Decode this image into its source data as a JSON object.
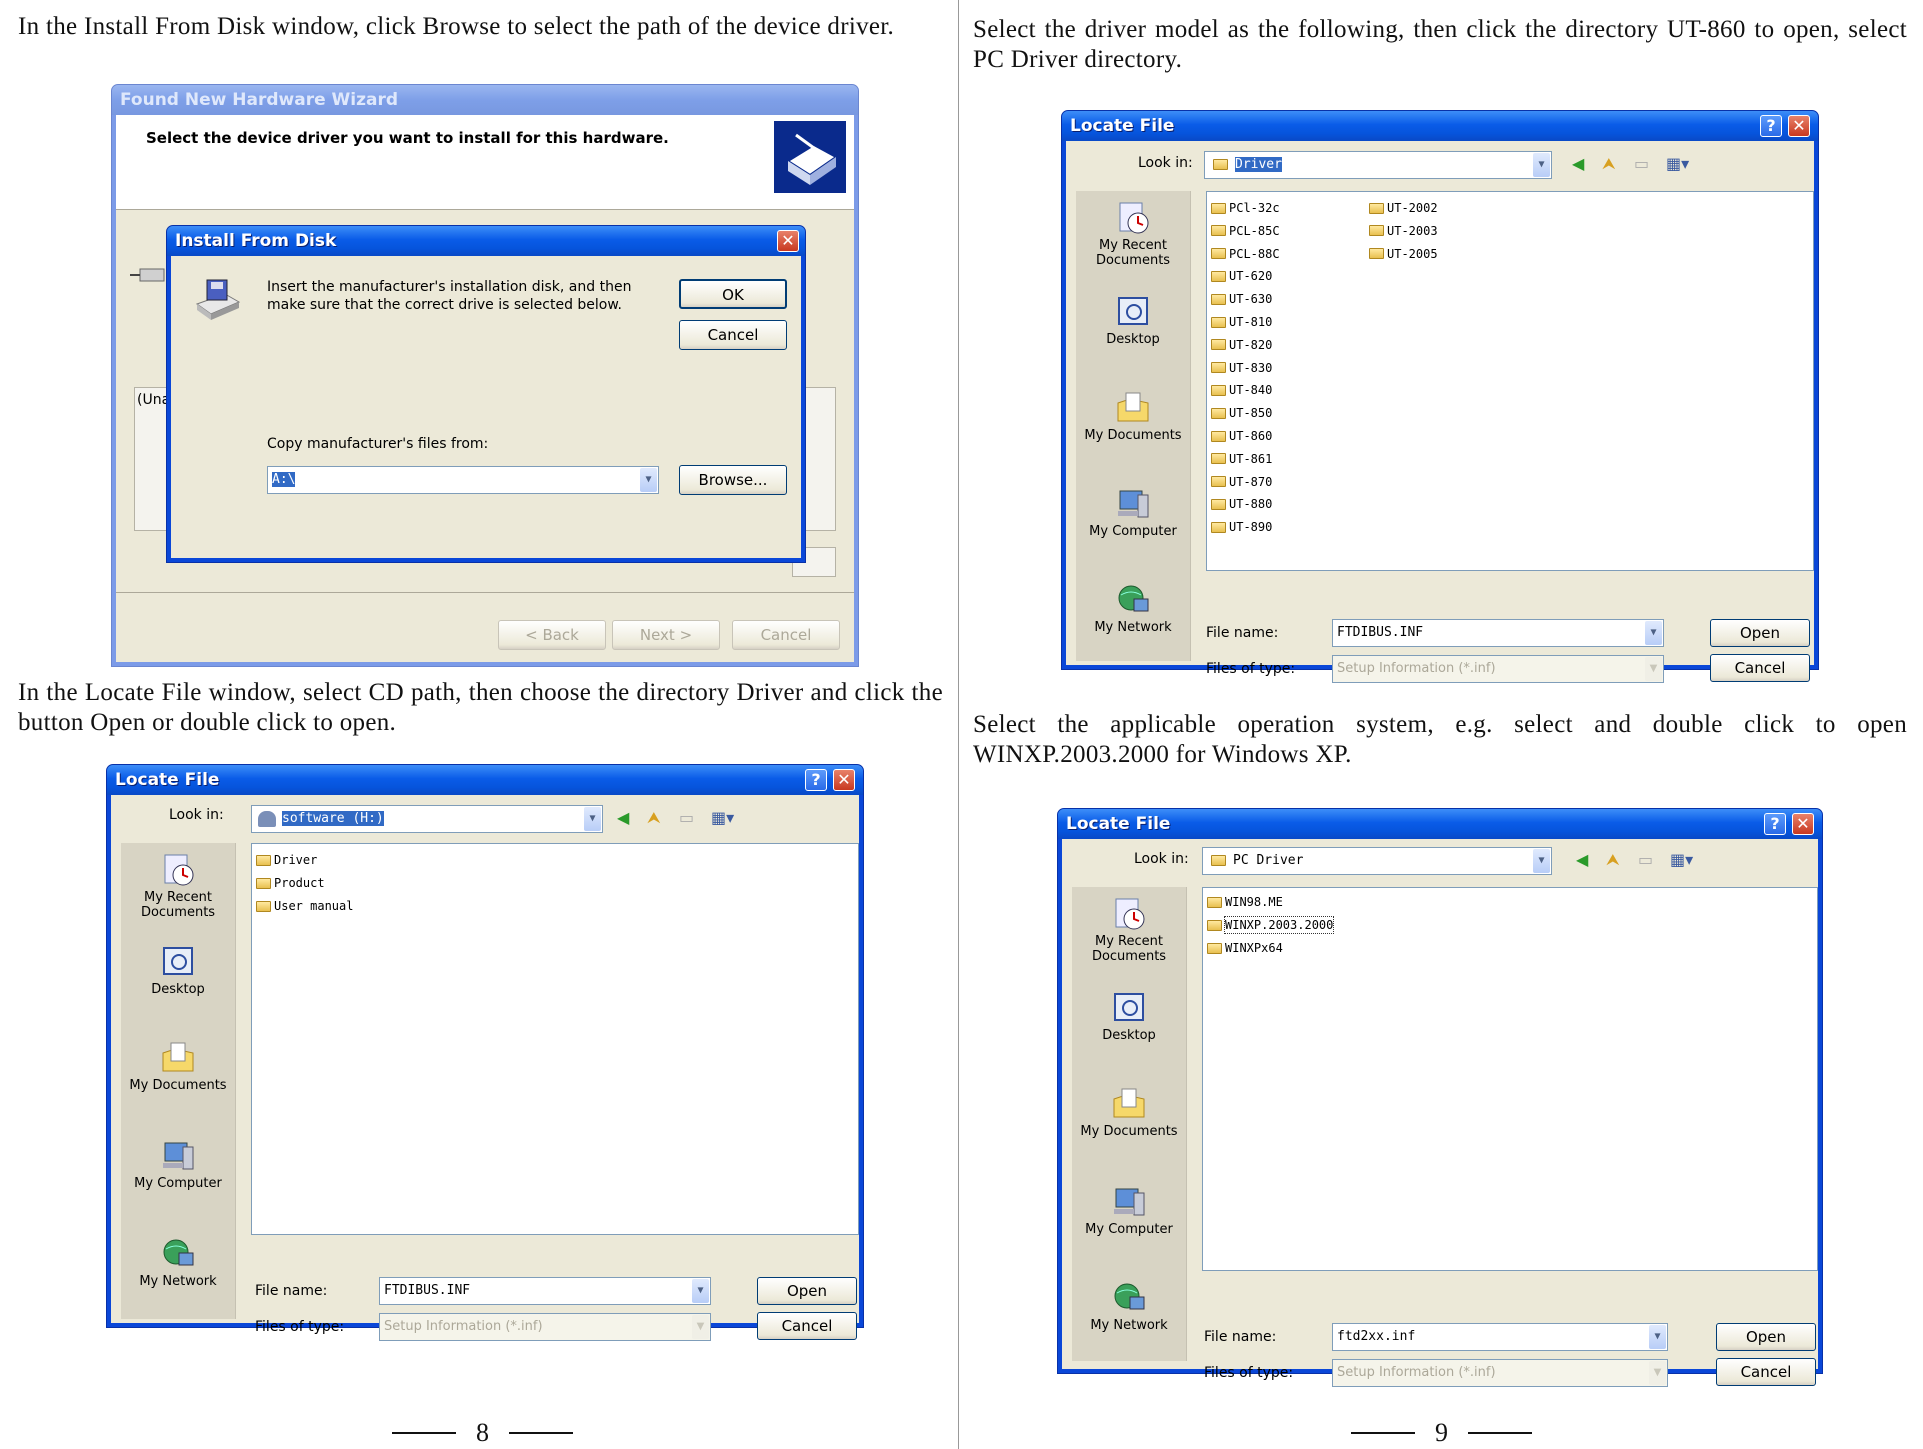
{
  "left_page": {
    "para1": "In the Install From Disk window, click Browse to select the path of the device driver.",
    "para2": "In the Locate File window, select CD path, then choose the directory Driver and click the button Open or double click to open.",
    "page_number": "8"
  },
  "right_page": {
    "para1": "Select the driver model as the following, then click the directory UT-860 to open, select PC Driver directory.",
    "para2": "Select the applicable operation system, e.g. select and double click to open WINXP.2003.2000 for Windows XP.",
    "page_number": "9"
  },
  "wizard": {
    "title": "Found New Hardware Wizard",
    "heading": "Select the device driver you want to install for this hardware.",
    "partial_label": "(Una",
    "back": "< Back",
    "next": "Next >",
    "cancel": "Cancel"
  },
  "install_disk": {
    "title": "Install From Disk",
    "message": "Insert the manufacturer's installation disk, and then make sure that the correct drive is selected below.",
    "ok": "OK",
    "cancel": "Cancel",
    "copy_label": "Copy manufacturer's files from:",
    "path": "A:\\",
    "browse": "Browse..."
  },
  "locate_common": {
    "title": "Locate File",
    "look_in": "Look in:",
    "file_name_label": "File name:",
    "files_of_type_label": "Files of type:",
    "files_of_type": "Setup Information (*.inf)",
    "open": "Open",
    "cancel": "Cancel",
    "places": [
      "My Recent Documents",
      "Desktop",
      "My Documents",
      "My Computer",
      "My Network"
    ]
  },
  "locate1": {
    "look_in_value": "software (H:)",
    "file_name": "FTDIBUS.INF",
    "items": [
      "Driver",
      "Product",
      "User manual"
    ]
  },
  "locate2": {
    "look_in_value": "Driver",
    "file_name": "FTDIBUS.INF",
    "items_col1": [
      "PCl-32c",
      "PCL-85C",
      "PCL-88C",
      "UT-620",
      "UT-630",
      "UT-810",
      "UT-820",
      "UT-830",
      "UT-840",
      "UT-850",
      "UT-860",
      "UT-861",
      "UT-870",
      "UT-880",
      "UT-890"
    ],
    "items_col2": [
      "UT-2002",
      "UT-2003",
      "UT-2005"
    ]
  },
  "locate3": {
    "look_in_value": "PC Driver",
    "file_name": "ftd2xx.inf",
    "items": [
      "WIN98.ME",
      "WINXP.2003.2000",
      "WINXPx64"
    ]
  }
}
